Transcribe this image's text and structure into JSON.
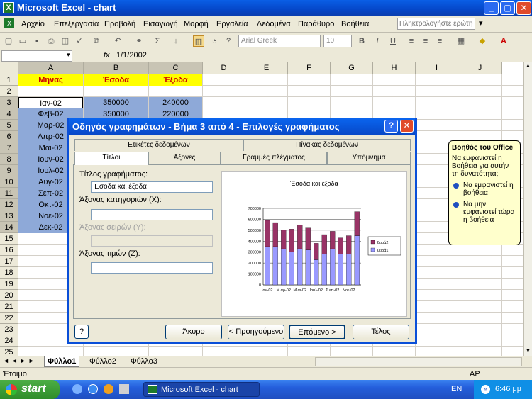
{
  "window": {
    "title": "Microsoft Excel - chart"
  },
  "menu": [
    "Αρχείο",
    "Επεξεργασία",
    "Προβολή",
    "Εισαγωγή",
    "Μορφή",
    "Εργαλεία",
    "Δεδομένα",
    "Παράθυρο",
    "Βοήθεια"
  ],
  "help_search": {
    "placeholder": "Πληκτρολογήστε ερώτηση"
  },
  "toolbar": {
    "font": "Arial Greek",
    "size": "10"
  },
  "formula": {
    "fx": "fx",
    "value": "1/1/2002"
  },
  "columns": [
    "A",
    "B",
    "C",
    "D",
    "E",
    "F",
    "G",
    "H",
    "I",
    "J"
  ],
  "rows": [
    "1",
    "2",
    "3",
    "4",
    "5",
    "6",
    "7",
    "8",
    "9",
    "10",
    "11",
    "12",
    "13",
    "14",
    "15",
    "16",
    "17",
    "18",
    "19",
    "20",
    "21",
    "22",
    "23",
    "24",
    "25"
  ],
  "sheet": {
    "headers": [
      "Μηνας",
      "Έσοδα",
      "Έξοδα"
    ],
    "data": [
      [
        "Ιαν-02",
        "350000",
        "240000"
      ],
      [
        "Φεβ-02",
        "350000",
        "220000"
      ],
      [
        "Μαρ-02",
        "",
        "",
        ""
      ],
      [
        "Απρ-02",
        "",
        ""
      ],
      [
        "Μαι-02",
        "",
        ""
      ],
      [
        "Ιουν-02",
        "",
        ""
      ],
      [
        "Ιουλ-02",
        "",
        ""
      ],
      [
        "Αυγ-02",
        "",
        ""
      ],
      [
        "Σεπ-02",
        "",
        ""
      ],
      [
        "Οκτ-02",
        "",
        ""
      ],
      [
        "Νοε-02",
        "",
        ""
      ],
      [
        "Δεκ-02",
        "",
        ""
      ]
    ]
  },
  "sheet_tabs": [
    "Φύλλο1",
    "Φύλλο2",
    "Φύλλο3"
  ],
  "status": {
    "left": "Έτοιμο",
    "right": "ΑΡ"
  },
  "taskbar": {
    "start": "start",
    "app": "Microsoft Excel - chart",
    "lang": "EN",
    "time": "6:46 μμ"
  },
  "dialog": {
    "title": "Οδηγός γραφημάτων - Βήμα 3 από 4 - Επιλογές γραφήματος",
    "tabs_back": [
      "Ετικέτες δεδομένων",
      "Πίνακας δεδομένων"
    ],
    "tabs_front": [
      "Τίτλοι",
      "Άξονες",
      "Γραμμές πλέγματος",
      "Υπόμνημα"
    ],
    "fields": [
      {
        "label": "Τίτλος γραφήματος:",
        "value": "Έσοδα και έξοδα"
      },
      {
        "label": "Άξονας κατηγοριών (X):",
        "value": ""
      },
      {
        "label": "Άξονας σειρών (Y):",
        "value": ""
      },
      {
        "label": "Άξονας τιμών (Z):",
        "value": ""
      }
    ],
    "buttons": {
      "cancel": "Άκυρο",
      "back": "< Προηγούμενο",
      "next": "Επόμενο >",
      "finish": "Τέλος"
    }
  },
  "help_bubble": {
    "title": "Βοηθός του Office",
    "text": "Να εμφανιστεί η Βοήθεια για αυτήν τη δυνατότητα;",
    "opt1": "Να εμφανιστεί η βοήθεια",
    "opt2": "Να μην εμφανιστεί τώρα η βοήθεια"
  },
  "chart_data": {
    "type": "bar",
    "title": "Έσοδα και έξοδα",
    "stacked": true,
    "categories": [
      "Ιαν-02",
      "Φεβ-02",
      "Μαρ-02",
      "Απρ-02",
      "Μαι-02",
      "Ιουν-02",
      "Ιουλ-02",
      "Αυγ-02",
      "Σεπ-02",
      "Οκτ-02",
      "Νοε-02",
      "Δεκ-02"
    ],
    "x_tick_labels": [
      "Ιαν-02",
      "Μ αρ-02",
      "Μ αι-02",
      "Ιουλ-02",
      "Σ επ-02",
      "Νοε-02"
    ],
    "series": [
      {
        "name": "Σειρά1",
        "color": "#9999ff",
        "values": [
          350000,
          350000,
          330000,
          300000,
          330000,
          320000,
          230000,
          280000,
          330000,
          280000,
          280000,
          450000
        ]
      },
      {
        "name": "Σειρά2",
        "color": "#993366",
        "values": [
          240000,
          220000,
          170000,
          210000,
          220000,
          200000,
          150000,
          180000,
          160000,
          150000,
          170000,
          220000
        ]
      }
    ],
    "yticks": [
      "0",
      "100000",
      "200000",
      "300000",
      "400000",
      "500000",
      "600000",
      "700000"
    ],
    "ylim": [
      0,
      700000
    ],
    "legend": "right"
  }
}
